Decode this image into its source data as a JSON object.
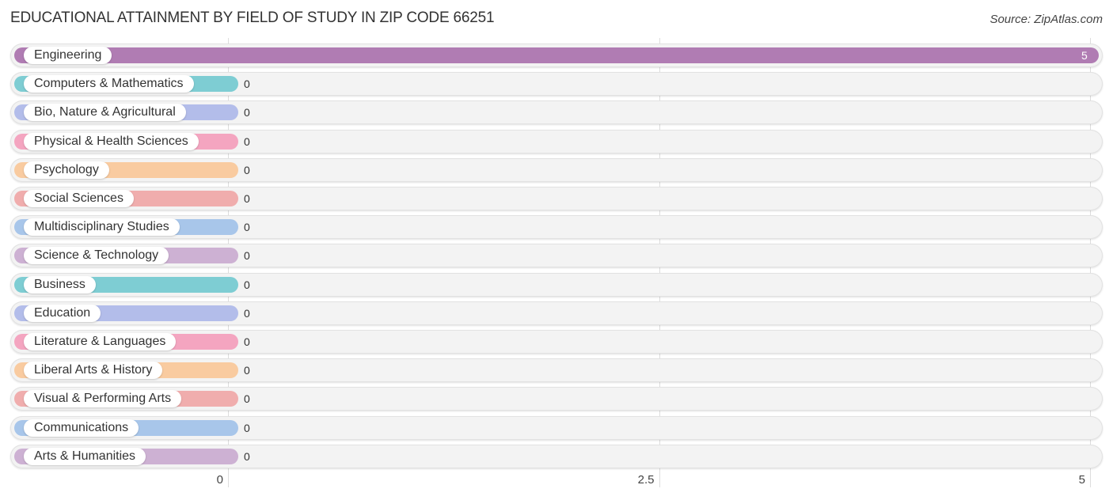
{
  "chart_data": {
    "type": "bar",
    "orientation": "horizontal",
    "title": "EDUCATIONAL ATTAINMENT BY FIELD OF STUDY IN ZIP CODE 66251",
    "source": "Source: ZipAtlas.com",
    "xlabel": "",
    "ylabel": "",
    "xlim": [
      0,
      5
    ],
    "xticks": [
      0,
      2.5,
      5
    ],
    "xtick_labels": [
      "0",
      "2.5",
      "5"
    ],
    "grid": true,
    "categories": [
      "Engineering",
      "Computers & Mathematics",
      "Bio, Nature & Agricultural",
      "Physical & Health Sciences",
      "Psychology",
      "Social Sciences",
      "Multidisciplinary Studies",
      "Science & Technology",
      "Business",
      "Education",
      "Literature & Languages",
      "Liberal Arts & History",
      "Visual & Performing Arts",
      "Communications",
      "Arts & Humanities"
    ],
    "values": [
      5,
      0,
      0,
      0,
      0,
      0,
      0,
      0,
      0,
      0,
      0,
      0,
      0,
      0,
      0
    ],
    "value_labels": [
      "5",
      "0",
      "0",
      "0",
      "0",
      "0",
      "0",
      "0",
      "0",
      "0",
      "0",
      "0",
      "0",
      "0",
      "0"
    ],
    "colors": [
      "#b07cb3",
      "#7ecdd3",
      "#b3bdea",
      "#f4a5c0",
      "#f9cba0",
      "#f0adad",
      "#a8c6ea",
      "#cdb1d3",
      "#7ecdd3",
      "#b3bdea",
      "#f4a5c0",
      "#f9cba0",
      "#f0adad",
      "#a8c6ea",
      "#cdb1d3"
    ]
  }
}
